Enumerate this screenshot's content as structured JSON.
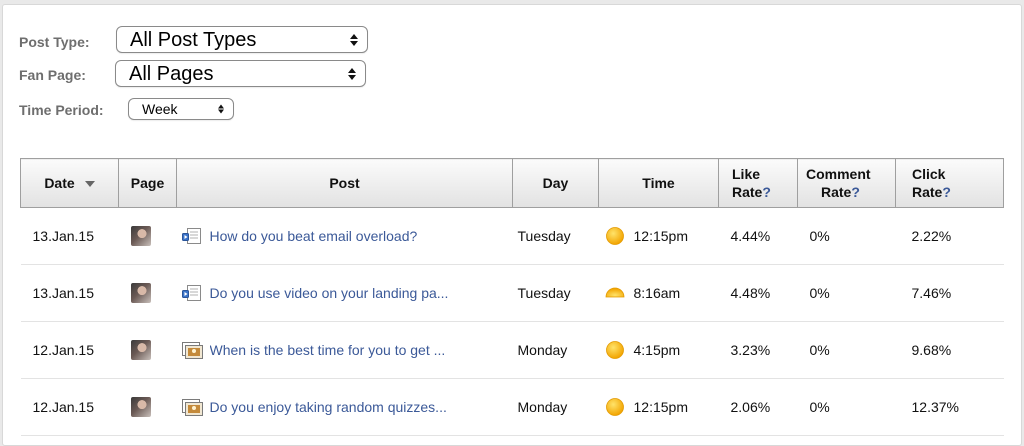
{
  "filters": {
    "post_type": {
      "label": "Post Type:",
      "value": "All Post Types"
    },
    "fan_page": {
      "label": "Fan Page:",
      "value": "All Pages"
    },
    "time_period": {
      "label": "Time Period:",
      "value": "Week"
    }
  },
  "table": {
    "columns": {
      "date": "Date",
      "page": "Page",
      "post": "Post",
      "day": "Day",
      "time": "Time",
      "like_rate_l1": "Like",
      "like_rate_l2": "Rate",
      "comment_rate_l1": "Comment",
      "comment_rate_l2": "Rate",
      "click_rate_l1": "Click",
      "click_rate_l2": "Rate",
      "help": "?"
    },
    "rows": [
      {
        "date": "13.Jan.15",
        "post_type_icon": "link-post-icon",
        "post": "How do you beat email overload?",
        "day": "Tuesday",
        "time_icon": "sun-icon",
        "time": "12:15pm",
        "like_rate": "4.44%",
        "comment_rate": "0%",
        "click_rate": "2.22%"
      },
      {
        "date": "13.Jan.15",
        "post_type_icon": "link-post-icon",
        "post": "Do you use video on your landing pa...",
        "day": "Tuesday",
        "time_icon": "sunrise-icon",
        "time": "8:16am",
        "like_rate": "4.48%",
        "comment_rate": "0%",
        "click_rate": "7.46%"
      },
      {
        "date": "12.Jan.15",
        "post_type_icon": "photo-post-icon",
        "post": "When is the best time for you to get ...",
        "day": "Monday",
        "time_icon": "sun-icon",
        "time": "4:15pm",
        "like_rate": "3.23%",
        "comment_rate": "0%",
        "click_rate": "9.68%"
      },
      {
        "date": "12.Jan.15",
        "post_type_icon": "photo-post-icon",
        "post": "Do you enjoy taking random quizzes...",
        "day": "Monday",
        "time_icon": "sun-icon",
        "time": "12:15pm",
        "like_rate": "2.06%",
        "comment_rate": "0%",
        "click_rate": "12.37%"
      }
    ]
  },
  "colors": {
    "link": "#3b5998",
    "label": "#6e6e6e",
    "header_border": "#9f9f9f",
    "sun": "#f6b700"
  }
}
